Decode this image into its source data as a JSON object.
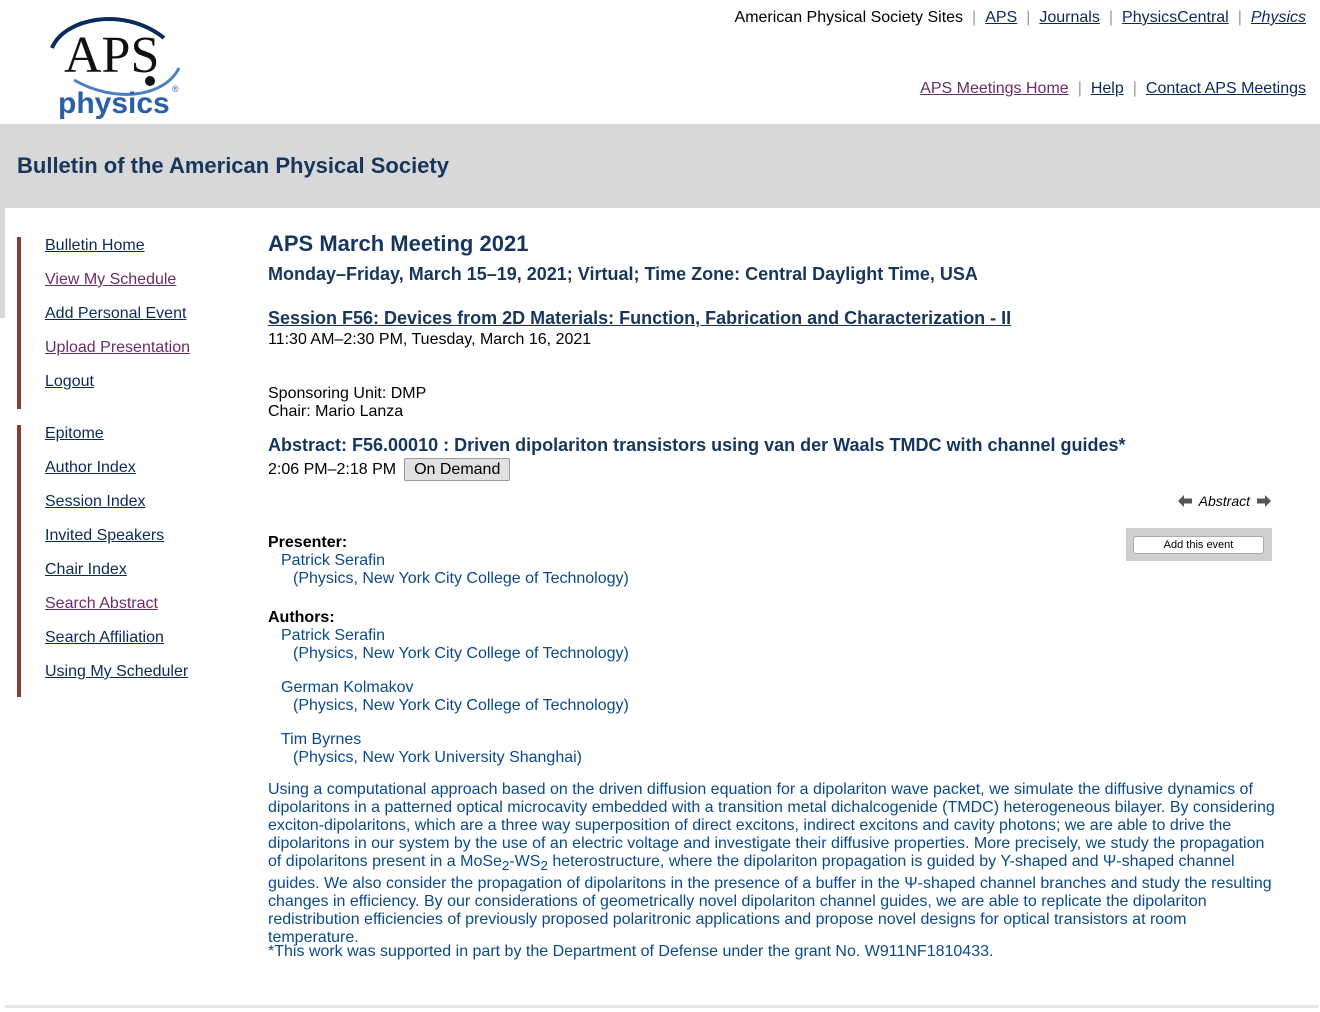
{
  "header": {
    "logo_text_top": "APS",
    "logo_text_bottom": "physics",
    "logo_registered": "®",
    "sites_label": "American Physical Society Sites",
    "sites": [
      "APS",
      "Journals",
      "PhysicsCentral",
      "Physics"
    ],
    "meeting_links": [
      "APS Meetings Home",
      "Help",
      "Contact APS Meetings"
    ]
  },
  "banner": {
    "title": "Bulletin of the American Physical Society"
  },
  "sidebar": {
    "group1": [
      "Bulletin Home",
      "View My Schedule",
      "Add Personal Event",
      "Upload Presentation",
      "Logout"
    ],
    "group2": [
      "Epitome",
      "Author Index",
      "Session Index",
      "Invited Speakers",
      "Chair Index",
      "Search Abstract",
      "Search Affiliation",
      "Using My Scheduler"
    ]
  },
  "meeting": {
    "title": "APS March Meeting 2021",
    "dates": "Monday–Friday, March 15–19, 2021; Virtual; Time Zone: Central Daylight Time, USA"
  },
  "session": {
    "title": "Session F56: Devices from 2D Materials: Function, Fabrication and Characterization - II",
    "time": "11:30 AM–2:30 PM, Tuesday, March 16, 2021",
    "sponsor": "Sponsoring Unit: DMP",
    "chair": "Chair: Mario Lanza"
  },
  "abstract": {
    "title": "Abstract: F56.00010 : Driven dipolariton transistors using van der Waals TMDC with channel guides*",
    "time": "2:06 PM–2:18 PM",
    "on_demand_label": "On Demand",
    "nav_label": "Abstract",
    "add_event_label": "Add this event",
    "presenter_heading": "Presenter:",
    "presenter": {
      "name": "Patrick Serafin",
      "affiliation": "(Physics, New York City College of Technology)"
    },
    "authors_heading": "Authors:",
    "authors": [
      {
        "name": "Patrick Serafin",
        "affiliation": "(Physics, New York City College of Technology)"
      },
      {
        "name": "German Kolmakov",
        "affiliation": "(Physics, New York City College of Technology)"
      },
      {
        "name": "Tim Byrnes",
        "affiliation": "(Physics, New York University Shanghai)"
      }
    ],
    "body_part1": "Using a computational approach based on the driven diffusion equation for a dipolariton wave packet, we simulate the diffusive dynamics of dipolaritons in a patterned optical microcavity embedded with a transition metal dichalcogenide (TMDC) heterogeneous bilayer. By considering exciton-dipolaritons, which are a three way superposition of direct excitons, indirect excitons and cavity photons; we are able to drive the dipolaritons in our system by the use of an electric voltage and investigate their diffusive properties. More precisely, we study the propagation of dipolaritons present in a MoSe",
    "sub1": "2",
    "body_part2": "-WS",
    "sub2": "2",
    "body_part3": " heterostructure, where the dipolariton propagation is guided by Y-shaped and Ψ-shaped channel guides. We also consider the propagation of dipolaritons in the presence of a buffer in the Ψ-shaped channel branches and study the resulting changes in efficiency. By our considerations of geometrically novel dipolariton channel guides, we are able to replicate the dipolariton redistribution efficiencies of previously proposed polaritronic applications and propose novel designs for optical transistors at room temperature.",
    "grant": "*This work was supported in part by the Department of Defense under the grant No. W911NF1810433."
  }
}
